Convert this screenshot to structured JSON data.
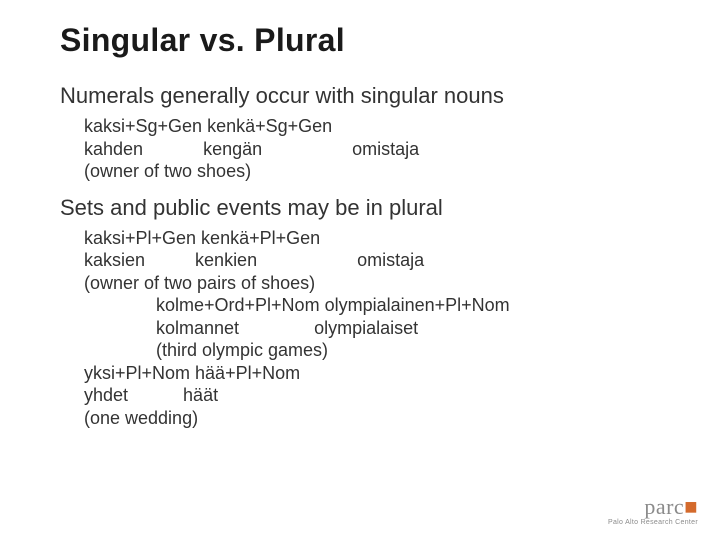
{
  "title": "Singular vs. Plural",
  "sec1": {
    "head": "Numerals generally occur with singular nouns",
    "l1": "kaksi+Sg+Gen kenkä+Sg+Gen",
    "l2": "kahden            kengän                  omistaja",
    "l3": "(owner of two shoes)"
  },
  "sec2": {
    "head": "Sets and public events may be in plural",
    "l1": "kaksi+Pl+Gen kenkä+Pl+Gen",
    "l2": "kaksien          kenkien                    omistaja",
    "l3": "(owner of two pairs of shoes)",
    "l4": "kolme+Ord+Pl+Nom olympialainen+Pl+Nom",
    "l5": "kolmannet               olympialaiset",
    "l6": "(third olympic games)",
    "l7": "yksi+Pl+Nom hää+Pl+Nom",
    "l8": "yhdet           häät",
    "l9": "(one wedding)"
  },
  "logo": {
    "main": "parc",
    "sub": "Palo Alto Research Center"
  }
}
